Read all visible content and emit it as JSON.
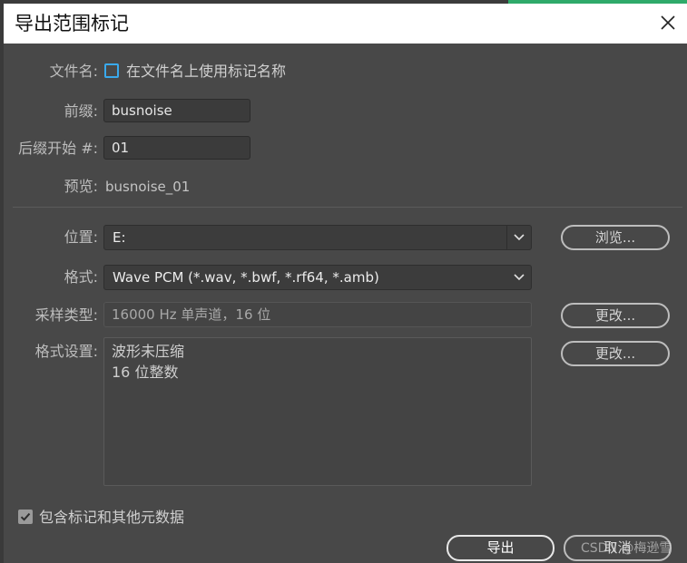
{
  "dialog": {
    "title": "导出范围标记"
  },
  "filename": {
    "label": "文件名:",
    "checkbox_label": "在文件名上使用标记名称",
    "checked": false
  },
  "prefix": {
    "label": "前缀:",
    "value": "busnoise"
  },
  "suffix": {
    "label": "后缀开始 #:",
    "value": "01"
  },
  "preview": {
    "label": "预览:",
    "value": "busnoise_01"
  },
  "location": {
    "label": "位置:",
    "value": "E:",
    "browse_label": "浏览..."
  },
  "format": {
    "label": "格式:",
    "value": "Wave PCM (*.wav, *.bwf, *.rf64, *.amb)"
  },
  "sample_type": {
    "label": "采样类型:",
    "value": "16000 Hz 单声道，16 位",
    "change_label": "更改..."
  },
  "format_settings": {
    "label": "格式设置:",
    "lines": [
      "波形未压缩",
      "16 位整数"
    ],
    "change_label": "更改..."
  },
  "include_markers": {
    "label": "包含标记和其他元数据",
    "checked": true
  },
  "buttons": {
    "export_label": "导出",
    "cancel_label": "取消"
  },
  "watermark": "CSDN @梅逊雪",
  "icons": {
    "close": "close-icon",
    "dropdown": "chevron-down-icon",
    "check": "check-icon"
  },
  "colors": {
    "background": "#484848",
    "accent_checkbox": "#39a9ec",
    "title_bar": "#ffffff"
  }
}
